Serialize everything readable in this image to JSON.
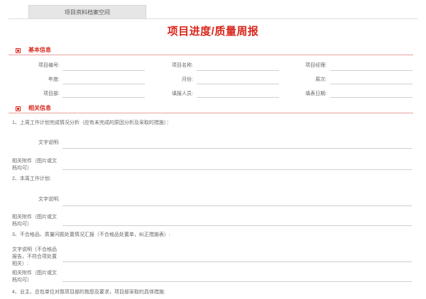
{
  "tab": {
    "label": "项目资料档案空间"
  },
  "page": {
    "title": "项目进度/质量周报"
  },
  "basic_section": {
    "title": "基本信息",
    "fields": [
      {
        "label": "项目编号:",
        "value": ""
      },
      {
        "label": "项目名称:",
        "value": ""
      },
      {
        "label": "项目经理:",
        "value": ""
      },
      {
        "label": "年度:",
        "value": ""
      },
      {
        "label": "月份:",
        "value": ""
      },
      {
        "label": "周次:",
        "value": ""
      },
      {
        "label": "项目部:",
        "value": ""
      },
      {
        "label": "填报人员:",
        "value": ""
      },
      {
        "label": "填表日期:",
        "value": ""
      }
    ]
  },
  "related_section": {
    "title": "相关信息",
    "questions": [
      {
        "text": "1、上周工作计划完成情况分析（应有未完成的原因分析及采取的措施）：",
        "rows": [
          {
            "label": "文字说明:"
          },
          {
            "label": "相关附件（图片或文档均可）"
          }
        ]
      },
      {
        "text": "2、本周工作计划:",
        "rows": [
          {
            "label": "文字说明:"
          },
          {
            "label": "相关附件（图片或文档均可）"
          }
        ]
      },
      {
        "text": "3、不合格品、质量问题处置情况汇报（不合格品处置单，纠正措施表）:",
        "rows": [
          {
            "label": "文字说明（不合格品报告，不符合项处置相关）:"
          },
          {
            "label": "相关附件（图片或文档均可）"
          }
        ]
      },
      {
        "text": "4、业主、总包单位对我项目部的抱怨及要求，项目部采取的具体措施:",
        "rows": []
      }
    ]
  },
  "colors": {
    "accent": "#d9261c",
    "section_line": "#e9a09b",
    "field_line": "#cfcfcf"
  }
}
